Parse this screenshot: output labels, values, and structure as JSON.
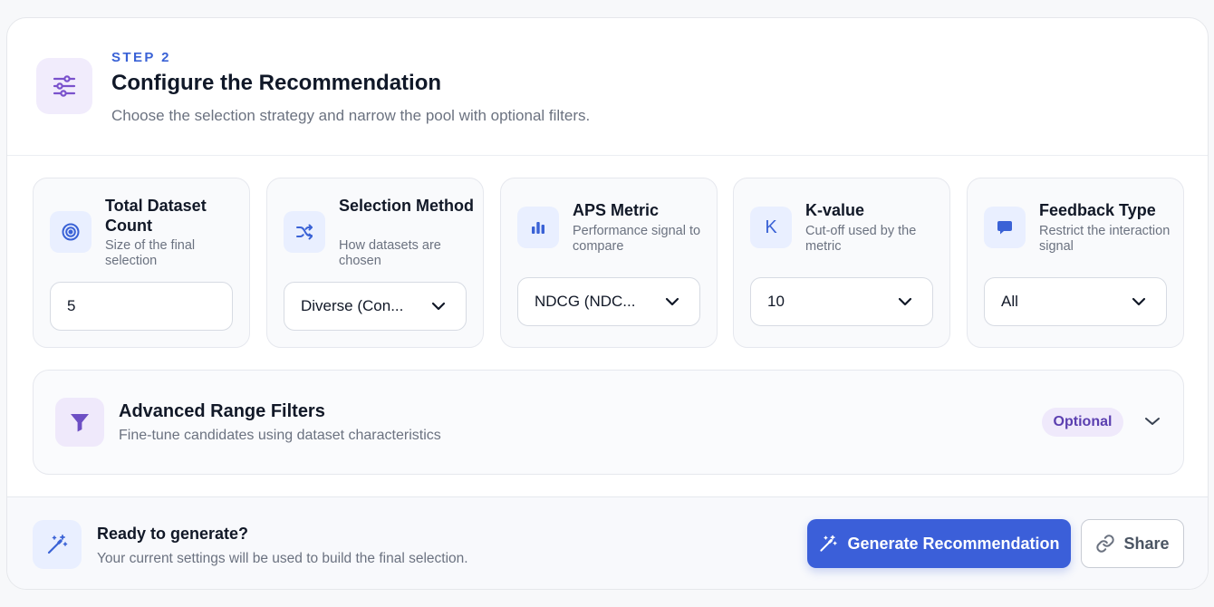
{
  "header": {
    "step": "STEP 2",
    "title": "Configure the Recommendation",
    "subtitle": "Choose the selection strategy and narrow the pool with optional filters."
  },
  "fields": [
    {
      "title": "Total Dataset Count",
      "description": "Size of the final selection",
      "value": "5",
      "control": "input",
      "icon": "target-icon"
    },
    {
      "title": "Selection Method",
      "description": "How datasets are chosen",
      "value": "Diverse (Con...",
      "control": "select",
      "icon": "shuffle-icon"
    },
    {
      "title": "APS Metric",
      "description": "Performance signal to compare",
      "value": "NDCG (NDC...",
      "control": "select",
      "icon": "bar-chart-icon"
    },
    {
      "title": "K-value",
      "description": "Cut-off used by the metric",
      "value": "10",
      "control": "select",
      "icon": "k-letter-icon",
      "icon_glyph": "K"
    },
    {
      "title": "Feedback Type",
      "description": "Restrict the interaction signal",
      "value": "All",
      "control": "select",
      "icon": "chat-bubble-icon"
    }
  ],
  "advanced": {
    "title": "Advanced Range Filters",
    "description": "Fine-tune candidates using dataset characteristics",
    "badge": "Optional"
  },
  "footer": {
    "title": "Ready to generate?",
    "description": "Your current settings will be used to build the final selection.",
    "generate_label": "Generate Recommendation",
    "share_label": "Share"
  },
  "colors": {
    "accent": "#3b5fd9",
    "purple": "#6d4fc4",
    "badge_text": "#5b3fb0"
  }
}
